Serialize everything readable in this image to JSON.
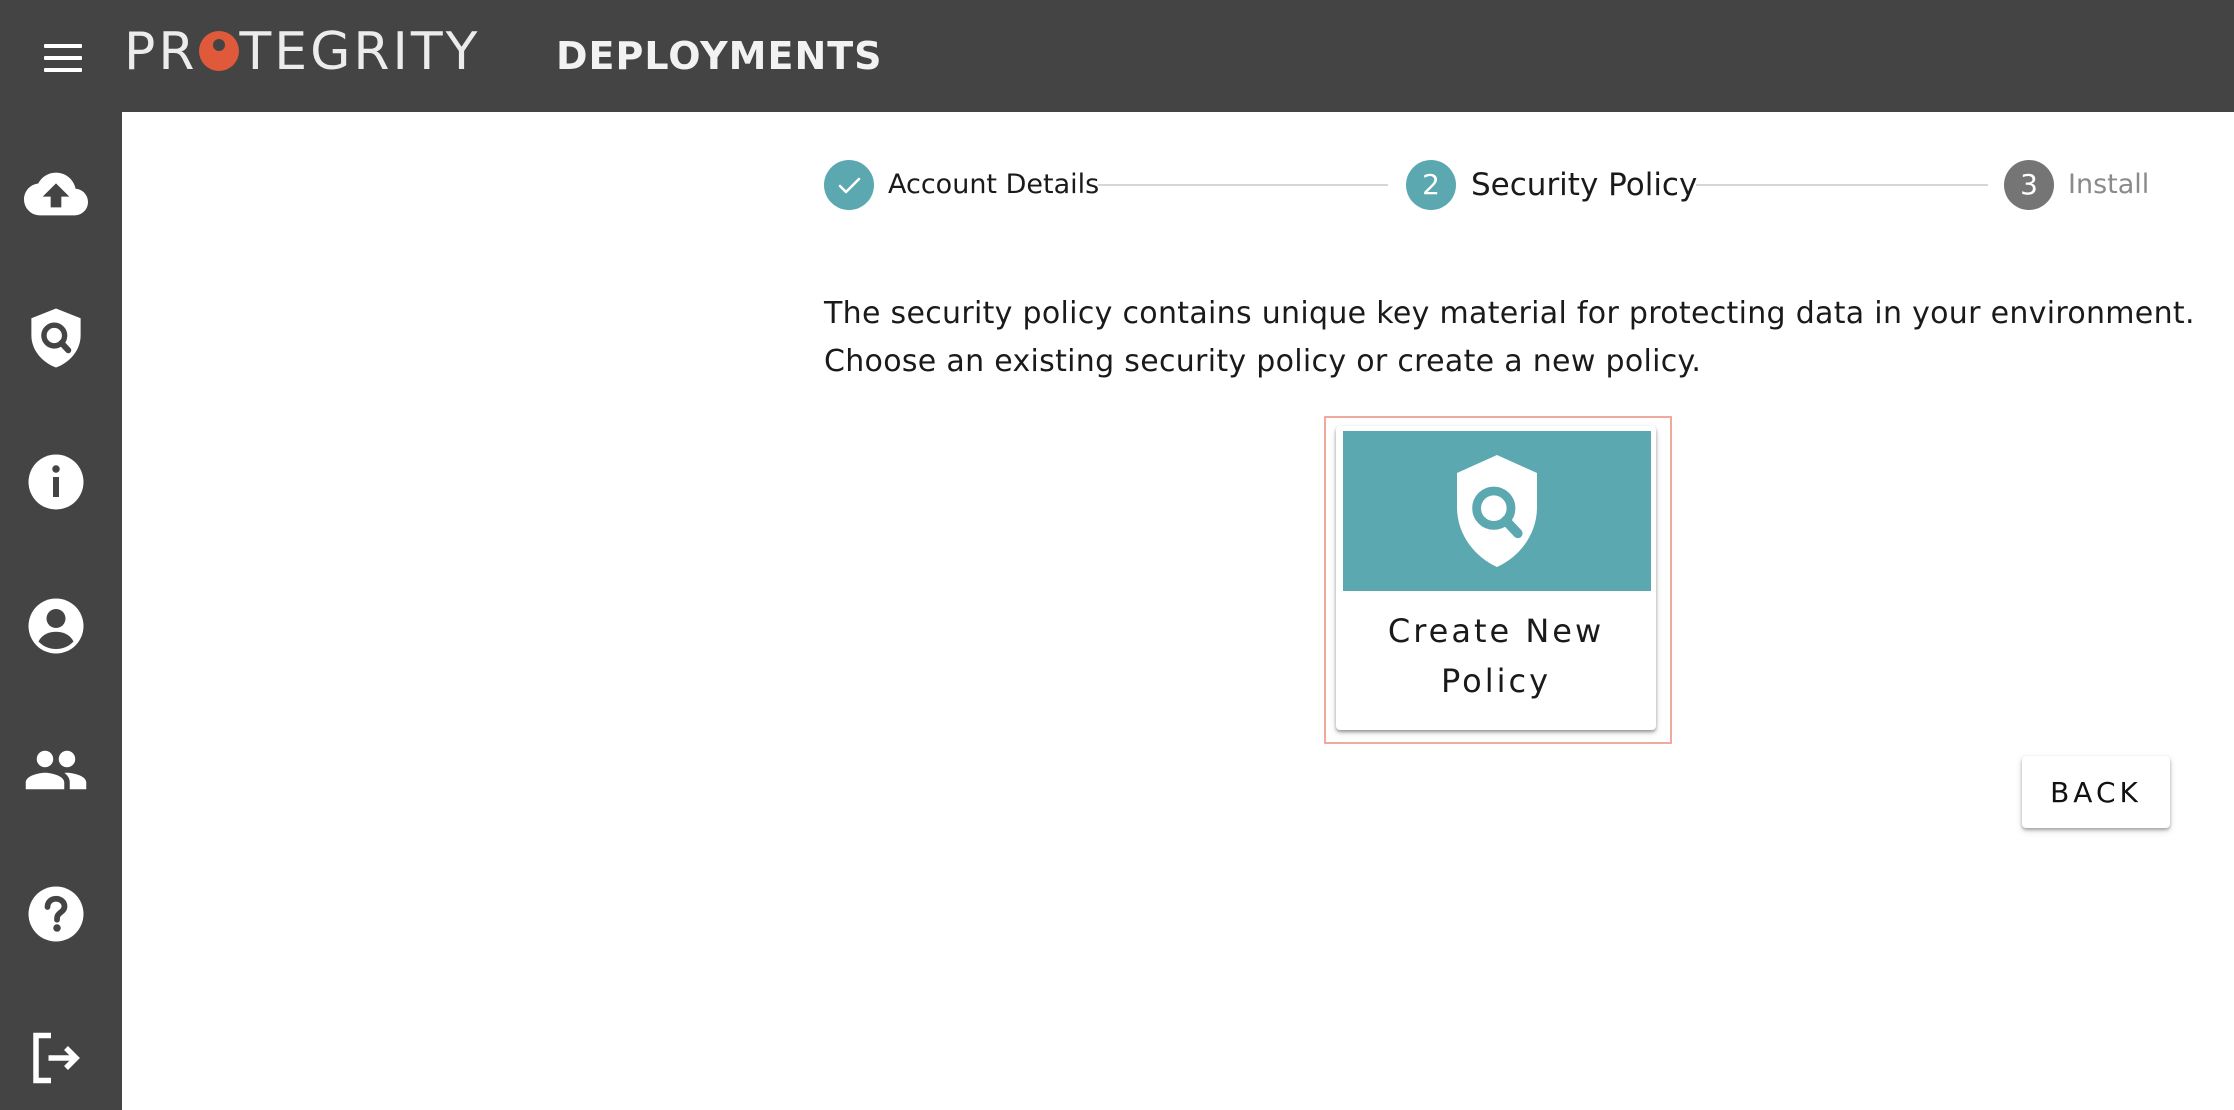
{
  "header": {
    "menu_icon": "hamburger-menu-icon",
    "logo_text_left": "PR",
    "logo_text_right": "TEGRITY",
    "page_title": "DEPLOYMENTS",
    "brand_accent": "#e0593a",
    "background": "#444444"
  },
  "sidebar": {
    "items": [
      {
        "icon": "cloud-upload-icon"
      },
      {
        "icon": "shield-search-icon"
      },
      {
        "icon": "info-icon"
      },
      {
        "icon": "account-circle-icon"
      },
      {
        "icon": "people-icon"
      },
      {
        "icon": "help-icon"
      },
      {
        "icon": "logout-icon"
      }
    ]
  },
  "stepper": {
    "steps": [
      {
        "label": "Account Details",
        "number": "",
        "state": "completed"
      },
      {
        "label": "Security Policy",
        "number": "2",
        "state": "active"
      },
      {
        "label": "Install",
        "number": "3",
        "state": "pending"
      }
    ],
    "active_color": "#5ba8b0",
    "pending_color": "#757575"
  },
  "intro": {
    "line1": "The security policy contains unique key material for protecting data in your environment.",
    "line2": "Choose an existing security policy or create a new policy."
  },
  "create_card": {
    "line1": "Create New",
    "line2": "Policy",
    "icon": "shield-search-icon",
    "media_color": "#5ba8b0"
  },
  "actions": {
    "back_label": "BACK"
  }
}
